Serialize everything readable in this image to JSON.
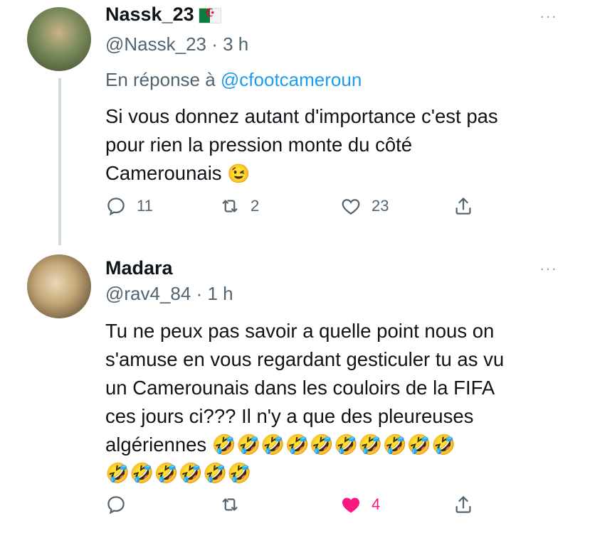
{
  "tweets": [
    {
      "name": "Nassk_23",
      "handle_time": "@Nassk_23 · 3 h",
      "reply_prefix": "En réponse à",
      "reply_mention": "@cfootcameroun",
      "text_lines": [
        "Si vous donnez autant d'importance c'est pas",
        "pour rien la pression monte du côté",
        "Cameroun​ais"
      ],
      "text_emoji": "😉",
      "replies": "11",
      "retweets": "2",
      "likes": "23",
      "more": "···"
    },
    {
      "name": "Madara",
      "handle_time": "@rav4_84 · 1 h",
      "text_lines": [
        "Tu ne peux pas savoir a quelle point nous on",
        "s'amuse en vous regardant gesticuler tu as vu",
        "un Camerounais dans les couloirs de la FIFA",
        "ces jours ci??? Il n'y a que des pleureuses",
        "algériennes 🤣🤣🤣🤣🤣🤣🤣🤣🤣🤣",
        "🤣🤣🤣🤣🤣🤣"
      ],
      "replies": "",
      "retweets": "",
      "likes": "4",
      "more": "···",
      "like_color": "#f91880"
    }
  ]
}
